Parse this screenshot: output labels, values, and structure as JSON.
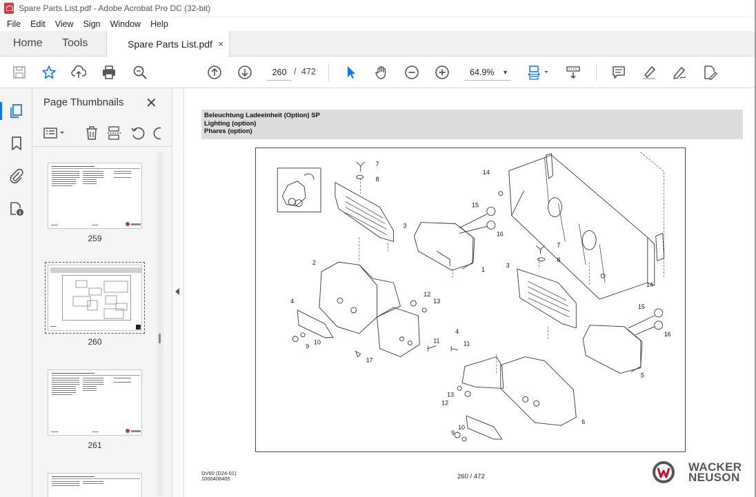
{
  "window": {
    "title": "Spare Parts List.pdf - Adobe Acrobat Pro DC (32-bit)"
  },
  "menu": [
    "File",
    "Edit",
    "View",
    "Sign",
    "Window",
    "Help"
  ],
  "tabs": {
    "home": "Home",
    "tools": "Tools",
    "document": "Spare Parts List.pdf",
    "close": "×"
  },
  "toolbar": {
    "page_current": "260",
    "page_separator": "/",
    "page_total": "472",
    "zoom": "64.9%",
    "accent_color": "#1473e6"
  },
  "thumbnails_panel": {
    "title": "Page Thumbnails",
    "close": "✕",
    "pages": [
      {
        "label": "259",
        "kind": "parts-list"
      },
      {
        "label": "260",
        "kind": "drawing",
        "selected": true
      },
      {
        "label": "261",
        "kind": "parts-list"
      }
    ]
  },
  "page": {
    "header_lines": [
      "Beleuchtung Ladeeinheit (Option) SP",
      "Lighting (option)",
      "Phares (option)"
    ],
    "footer_model": "DV60 (D24-01)",
    "footer_number": "1000408405",
    "page_indicator": "260 / 472",
    "brand_line1": "WACKER",
    "brand_line2": "NEUSON",
    "callouts": [
      "1",
      "2",
      "3",
      "3",
      "4",
      "4",
      "5",
      "6",
      "7",
      "7",
      "8",
      "8",
      "9",
      "9",
      "10",
      "10",
      "11",
      "11",
      "12",
      "12",
      "13",
      "13",
      "14",
      "14",
      "15",
      "15",
      "16",
      "16",
      "17"
    ]
  }
}
